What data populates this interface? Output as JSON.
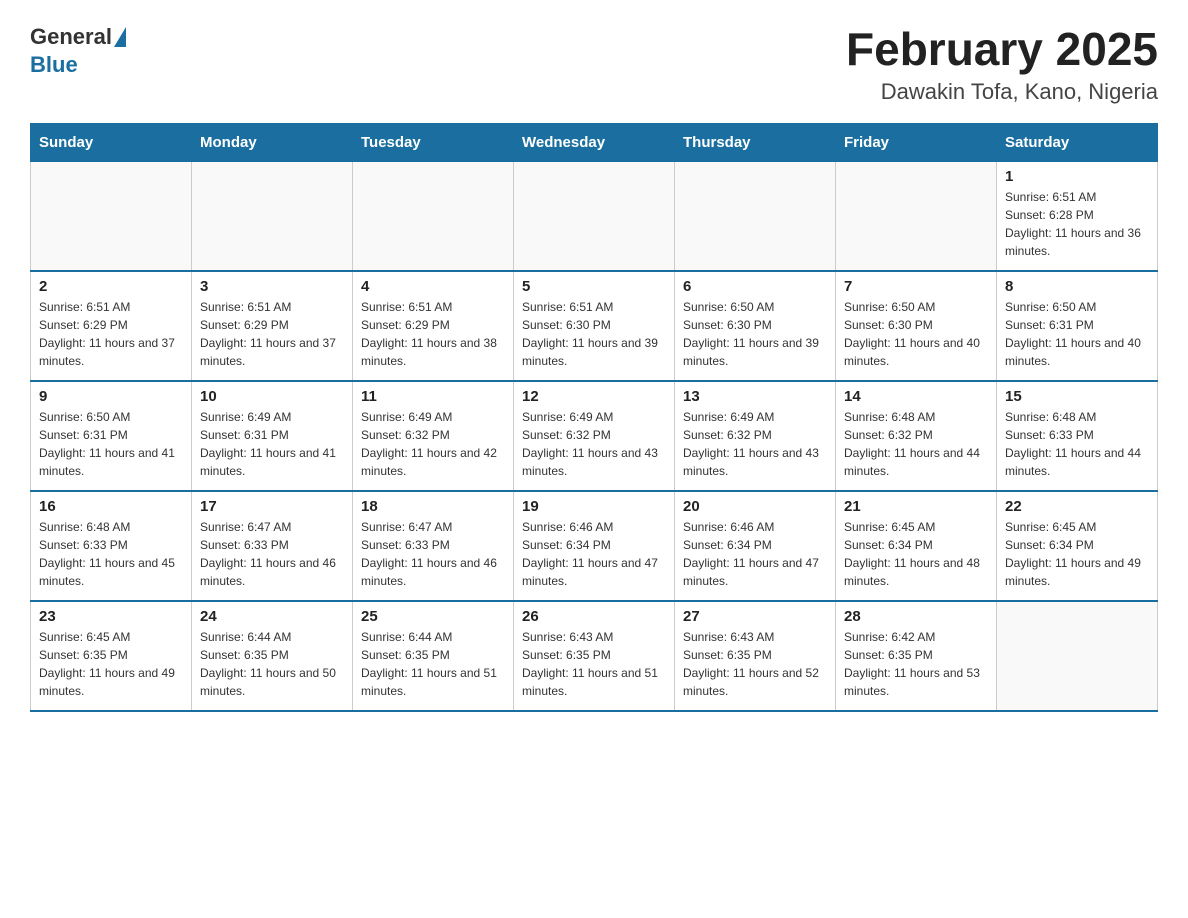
{
  "header": {
    "logo_general": "General",
    "logo_blue": "Blue",
    "title": "February 2025",
    "subtitle": "Dawakin Tofa, Kano, Nigeria"
  },
  "days_of_week": [
    "Sunday",
    "Monday",
    "Tuesday",
    "Wednesday",
    "Thursday",
    "Friday",
    "Saturday"
  ],
  "weeks": [
    [
      {
        "day": "",
        "sunrise": "",
        "sunset": "",
        "daylight": ""
      },
      {
        "day": "",
        "sunrise": "",
        "sunset": "",
        "daylight": ""
      },
      {
        "day": "",
        "sunrise": "",
        "sunset": "",
        "daylight": ""
      },
      {
        "day": "",
        "sunrise": "",
        "sunset": "",
        "daylight": ""
      },
      {
        "day": "",
        "sunrise": "",
        "sunset": "",
        "daylight": ""
      },
      {
        "day": "",
        "sunrise": "",
        "sunset": "",
        "daylight": ""
      },
      {
        "day": "1",
        "sunrise": "Sunrise: 6:51 AM",
        "sunset": "Sunset: 6:28 PM",
        "daylight": "Daylight: 11 hours and 36 minutes."
      }
    ],
    [
      {
        "day": "2",
        "sunrise": "Sunrise: 6:51 AM",
        "sunset": "Sunset: 6:29 PM",
        "daylight": "Daylight: 11 hours and 37 minutes."
      },
      {
        "day": "3",
        "sunrise": "Sunrise: 6:51 AM",
        "sunset": "Sunset: 6:29 PM",
        "daylight": "Daylight: 11 hours and 37 minutes."
      },
      {
        "day": "4",
        "sunrise": "Sunrise: 6:51 AM",
        "sunset": "Sunset: 6:29 PM",
        "daylight": "Daylight: 11 hours and 38 minutes."
      },
      {
        "day": "5",
        "sunrise": "Sunrise: 6:51 AM",
        "sunset": "Sunset: 6:30 PM",
        "daylight": "Daylight: 11 hours and 39 minutes."
      },
      {
        "day": "6",
        "sunrise": "Sunrise: 6:50 AM",
        "sunset": "Sunset: 6:30 PM",
        "daylight": "Daylight: 11 hours and 39 minutes."
      },
      {
        "day": "7",
        "sunrise": "Sunrise: 6:50 AM",
        "sunset": "Sunset: 6:30 PM",
        "daylight": "Daylight: 11 hours and 40 minutes."
      },
      {
        "day": "8",
        "sunrise": "Sunrise: 6:50 AM",
        "sunset": "Sunset: 6:31 PM",
        "daylight": "Daylight: 11 hours and 40 minutes."
      }
    ],
    [
      {
        "day": "9",
        "sunrise": "Sunrise: 6:50 AM",
        "sunset": "Sunset: 6:31 PM",
        "daylight": "Daylight: 11 hours and 41 minutes."
      },
      {
        "day": "10",
        "sunrise": "Sunrise: 6:49 AM",
        "sunset": "Sunset: 6:31 PM",
        "daylight": "Daylight: 11 hours and 41 minutes."
      },
      {
        "day": "11",
        "sunrise": "Sunrise: 6:49 AM",
        "sunset": "Sunset: 6:32 PM",
        "daylight": "Daylight: 11 hours and 42 minutes."
      },
      {
        "day": "12",
        "sunrise": "Sunrise: 6:49 AM",
        "sunset": "Sunset: 6:32 PM",
        "daylight": "Daylight: 11 hours and 43 minutes."
      },
      {
        "day": "13",
        "sunrise": "Sunrise: 6:49 AM",
        "sunset": "Sunset: 6:32 PM",
        "daylight": "Daylight: 11 hours and 43 minutes."
      },
      {
        "day": "14",
        "sunrise": "Sunrise: 6:48 AM",
        "sunset": "Sunset: 6:32 PM",
        "daylight": "Daylight: 11 hours and 44 minutes."
      },
      {
        "day": "15",
        "sunrise": "Sunrise: 6:48 AM",
        "sunset": "Sunset: 6:33 PM",
        "daylight": "Daylight: 11 hours and 44 minutes."
      }
    ],
    [
      {
        "day": "16",
        "sunrise": "Sunrise: 6:48 AM",
        "sunset": "Sunset: 6:33 PM",
        "daylight": "Daylight: 11 hours and 45 minutes."
      },
      {
        "day": "17",
        "sunrise": "Sunrise: 6:47 AM",
        "sunset": "Sunset: 6:33 PM",
        "daylight": "Daylight: 11 hours and 46 minutes."
      },
      {
        "day": "18",
        "sunrise": "Sunrise: 6:47 AM",
        "sunset": "Sunset: 6:33 PM",
        "daylight": "Daylight: 11 hours and 46 minutes."
      },
      {
        "day": "19",
        "sunrise": "Sunrise: 6:46 AM",
        "sunset": "Sunset: 6:34 PM",
        "daylight": "Daylight: 11 hours and 47 minutes."
      },
      {
        "day": "20",
        "sunrise": "Sunrise: 6:46 AM",
        "sunset": "Sunset: 6:34 PM",
        "daylight": "Daylight: 11 hours and 47 minutes."
      },
      {
        "day": "21",
        "sunrise": "Sunrise: 6:45 AM",
        "sunset": "Sunset: 6:34 PM",
        "daylight": "Daylight: 11 hours and 48 minutes."
      },
      {
        "day": "22",
        "sunrise": "Sunrise: 6:45 AM",
        "sunset": "Sunset: 6:34 PM",
        "daylight": "Daylight: 11 hours and 49 minutes."
      }
    ],
    [
      {
        "day": "23",
        "sunrise": "Sunrise: 6:45 AM",
        "sunset": "Sunset: 6:35 PM",
        "daylight": "Daylight: 11 hours and 49 minutes."
      },
      {
        "day": "24",
        "sunrise": "Sunrise: 6:44 AM",
        "sunset": "Sunset: 6:35 PM",
        "daylight": "Daylight: 11 hours and 50 minutes."
      },
      {
        "day": "25",
        "sunrise": "Sunrise: 6:44 AM",
        "sunset": "Sunset: 6:35 PM",
        "daylight": "Daylight: 11 hours and 51 minutes."
      },
      {
        "day": "26",
        "sunrise": "Sunrise: 6:43 AM",
        "sunset": "Sunset: 6:35 PM",
        "daylight": "Daylight: 11 hours and 51 minutes."
      },
      {
        "day": "27",
        "sunrise": "Sunrise: 6:43 AM",
        "sunset": "Sunset: 6:35 PM",
        "daylight": "Daylight: 11 hours and 52 minutes."
      },
      {
        "day": "28",
        "sunrise": "Sunrise: 6:42 AM",
        "sunset": "Sunset: 6:35 PM",
        "daylight": "Daylight: 11 hours and 53 minutes."
      },
      {
        "day": "",
        "sunrise": "",
        "sunset": "",
        "daylight": ""
      }
    ]
  ]
}
